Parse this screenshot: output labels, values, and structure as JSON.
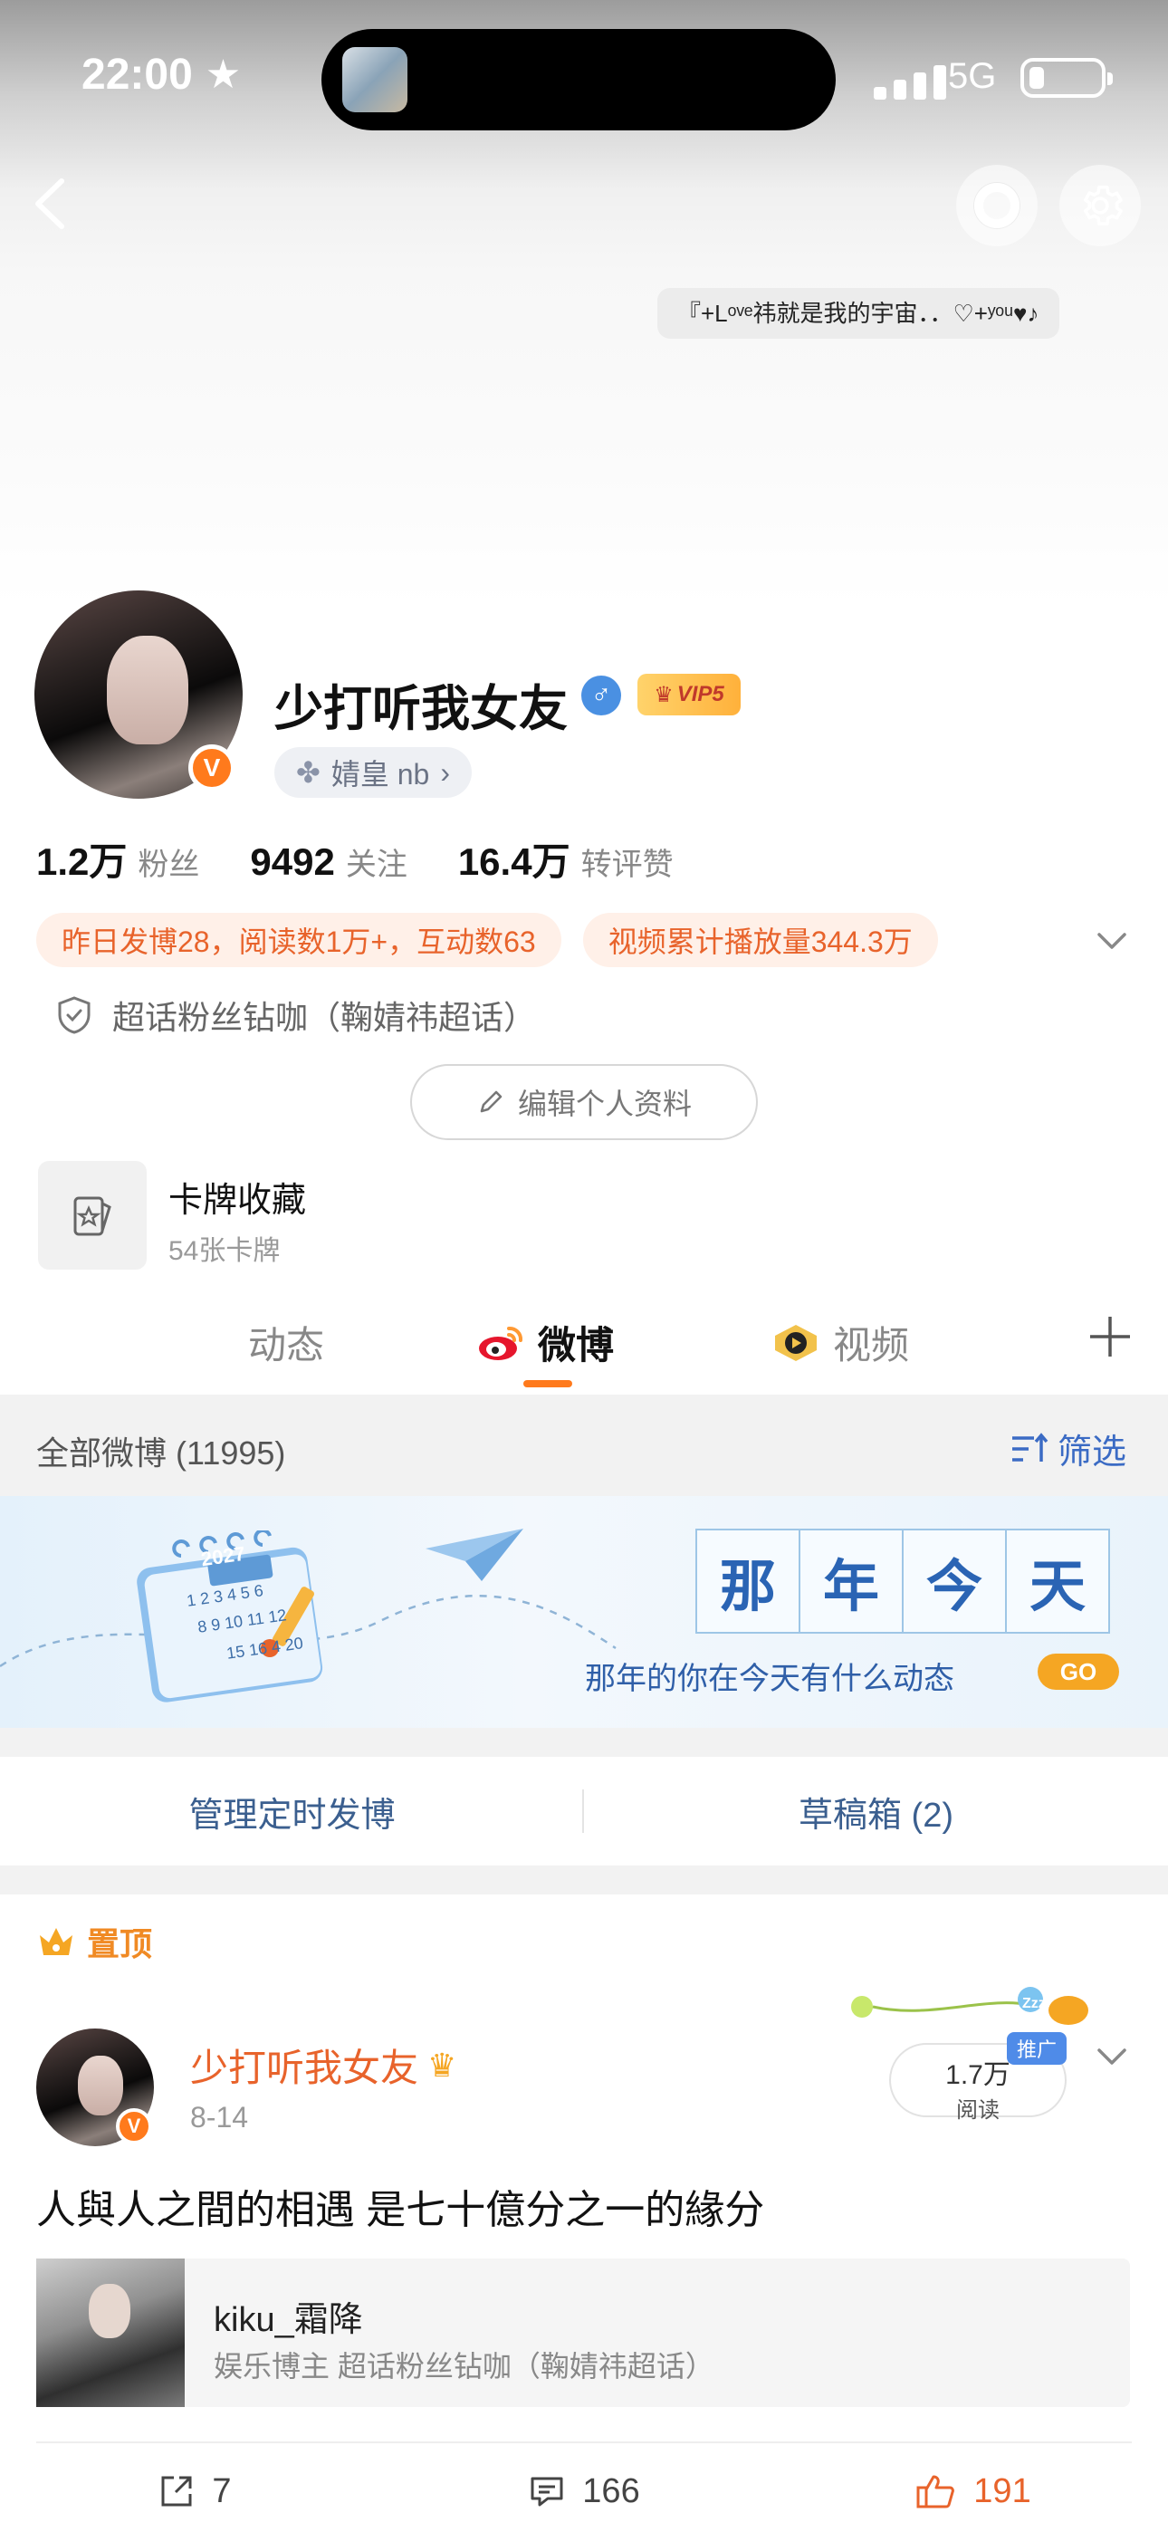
{
  "status_bar": {
    "time": "22:00",
    "network": "5G"
  },
  "profile": {
    "motto": "『+Lᵒᵛᵉ祎就是我的宇宙．．♡+ʸᵒᵘ♥♪",
    "name": "少打听我女友",
    "gender_symbol": "♂",
    "vip_label": "VIP5",
    "verified_mark": "V",
    "fan_club": "婧皇 nb",
    "stats": [
      {
        "value": "1.2万",
        "label": "粉丝"
      },
      {
        "value": "9492",
        "label": "关注"
      },
      {
        "value": "16.4万",
        "label": "转评赞"
      }
    ],
    "chips": [
      "昨日发博28，阅读数1万+，互动数63",
      "视频累计播放量344.3万"
    ],
    "superfan": "超话粉丝钻咖（鞠婧祎超话）",
    "edit_button": "编辑个人资料",
    "card": {
      "title": "卡牌收藏",
      "subtitle": "54张卡牌"
    }
  },
  "tabs": [
    {
      "label": "动态",
      "active": false
    },
    {
      "label": "微博",
      "active": true
    },
    {
      "label": "视频",
      "active": false
    }
  ],
  "filter": {
    "label": "全部微博 (11995)",
    "button": "筛选"
  },
  "banner": {
    "calendar_year": "2027",
    "calendar_days": "1 2 3 4 5 6",
    "calendar_days2": "8 9 10 11 12",
    "calendar_days3": "15 16 4 20",
    "title_chars": [
      "那",
      "年",
      "今",
      "天"
    ],
    "subtitle": "那年的你在今天有什么动态",
    "go": "GO"
  },
  "manage": {
    "scheduled": "管理定时发博",
    "drafts": "草稿箱 (2)"
  },
  "post": {
    "pinned_label": "置顶",
    "author": "少打听我女友",
    "date": "8-14",
    "reads_value": "1.7万",
    "reads_label": "阅读",
    "promo": "推广",
    "zzz": "Zzz",
    "text": "人與人之間的相遇   是七十億分之一的緣分",
    "embed": {
      "title": "kiku_霜降",
      "subtitle": "娱乐博主 超话粉丝钻咖（鞠婧祎超话）"
    },
    "actions": {
      "reposts": "7",
      "comments": "166",
      "likes": "191"
    }
  },
  "colors": {
    "accent": "#ff7a1c",
    "link": "#3b6bc4",
    "banner_blue": "#2a64b4"
  }
}
